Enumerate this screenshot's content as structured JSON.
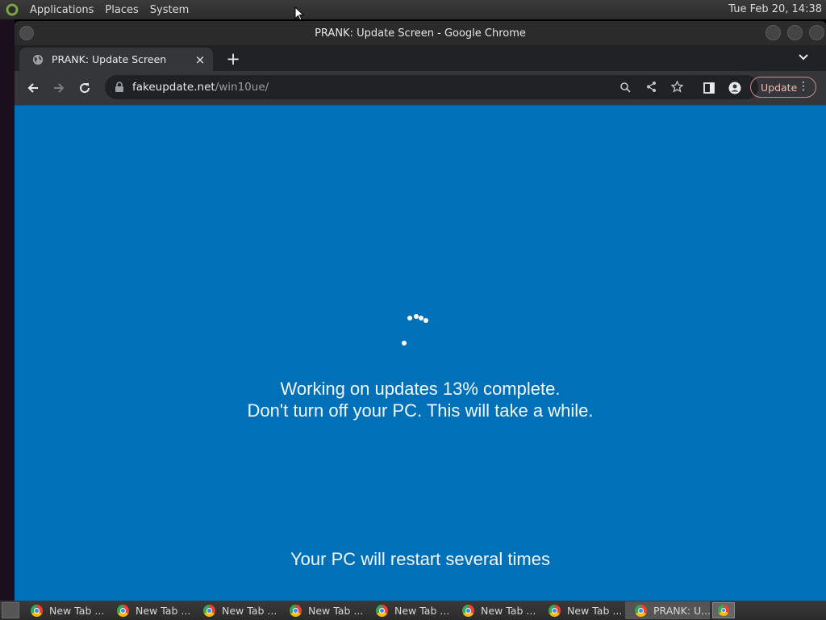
{
  "top_panel": {
    "menus": [
      "Applications",
      "Places",
      "System"
    ],
    "clock": "Tue Feb 20, 14:38"
  },
  "window": {
    "title": "PRANK: Update Screen - Google Chrome"
  },
  "tabs": [
    {
      "title": "PRANK: Update Screen",
      "close_icon": "×"
    }
  ],
  "toolbar": {
    "url_domain": "fakeupdate.net",
    "url_path": "/win10ue/",
    "update_label": "Update",
    "menu_icon": "⋮"
  },
  "page": {
    "line1": "Working on updates  13% complete.",
    "line2": "Don't turn off your PC. This will take a while.",
    "line3": "Your PC will restart several times",
    "progress_percent": 13,
    "background_color": "#0070b8"
  },
  "taskbar": {
    "tasks": [
      {
        "label": "New Tab ..."
      },
      {
        "label": "New Tab ..."
      },
      {
        "label": "New Tab ..."
      },
      {
        "label": "New Tab ..."
      },
      {
        "label": "New Tab ..."
      },
      {
        "label": "New Tab ..."
      },
      {
        "label": "New Tab ..."
      },
      {
        "label": "PRANK: U..."
      }
    ]
  }
}
